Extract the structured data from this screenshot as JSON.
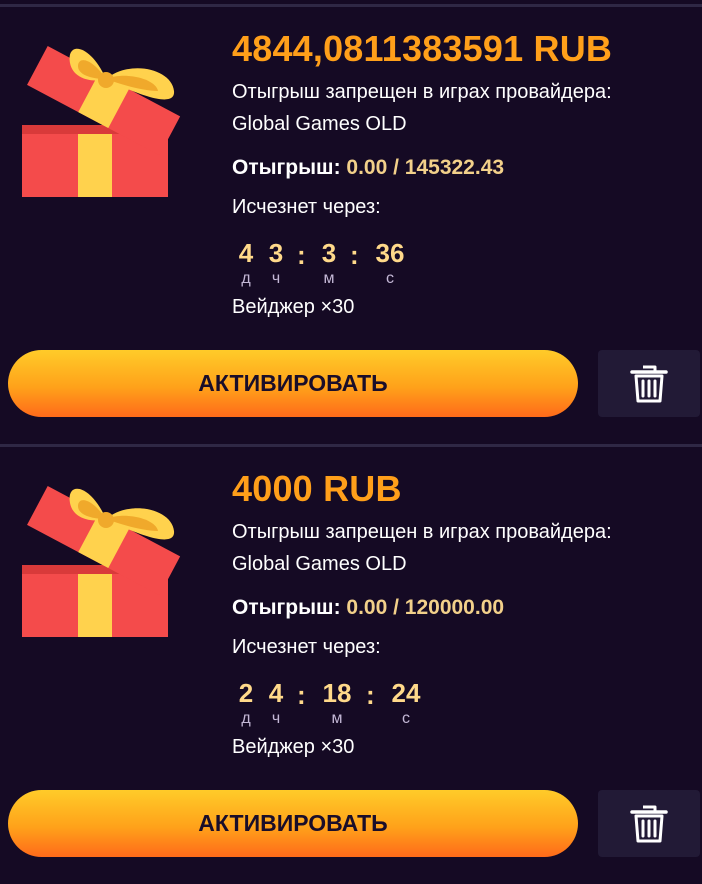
{
  "colors": {
    "background": "#150a24",
    "accent": "#ff9f1a",
    "value": "#f2d08a",
    "timer": "#ffd98a"
  },
  "bonuses": [
    {
      "amount": "4844,0811383591 RUB",
      "provider_note": "Отыгрыш запрещен в играх провайдера: Global Games OLD",
      "wager_label": "Отыгрыш:",
      "wager_value": "0.00 / 145322.43",
      "expires_label": "Исчезнет через:",
      "timer": [
        {
          "value": "4",
          "unit": "д"
        },
        {
          "value": "3",
          "unit": "ч"
        },
        {
          "value": "3",
          "unit": "м"
        },
        {
          "value": "36",
          "unit": "с"
        }
      ],
      "wager_multiplier": "Вейджер ×30",
      "activate_label": "АКТИВИРОВАТЬ",
      "icons": {
        "gift": "gift-icon",
        "delete": "trash-icon"
      }
    },
    {
      "amount": "4000 RUB",
      "provider_note": "Отыгрыш запрещен в играх провайдера: Global Games OLD",
      "wager_label": "Отыгрыш:",
      "wager_value": "0.00 / 120000.00",
      "expires_label": "Исчезнет через:",
      "timer": [
        {
          "value": "2",
          "unit": "д"
        },
        {
          "value": "4",
          "unit": "ч"
        },
        {
          "value": "18",
          "unit": "м"
        },
        {
          "value": "24",
          "unit": "с"
        }
      ],
      "wager_multiplier": "Вейджер ×30",
      "activate_label": "АКТИВИРОВАТЬ",
      "icons": {
        "gift": "gift-icon",
        "delete": "trash-icon"
      }
    }
  ]
}
